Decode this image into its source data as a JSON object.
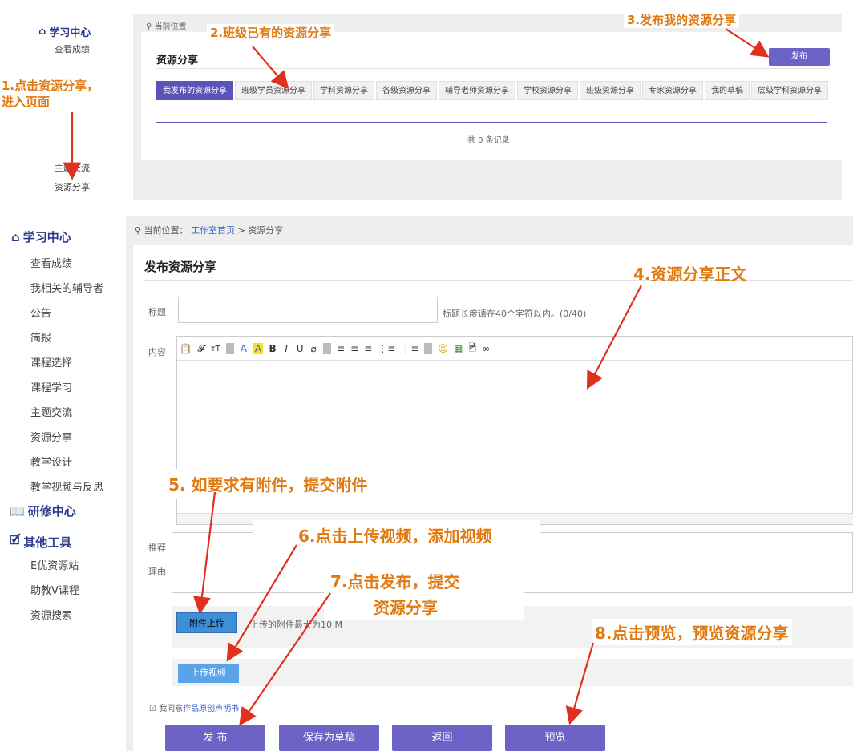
{
  "top": {
    "sidebar": {
      "head": "学习中心",
      "items": [
        "查看成绩",
        "主题交流",
        "资源分享"
      ]
    },
    "location": "当前位置",
    "section_title": "资源分享",
    "publish_button": "发布",
    "tabs": [
      "我发布的资源分享",
      "班级学员资源分享",
      "学科资源分享",
      "各级资源分享",
      "辅导老师资源分享",
      "学校资源分享",
      "班级资源分享",
      "专家资源分享",
      "我的草稿",
      "层级学科资源分享"
    ],
    "record_count": "共 0 条记录"
  },
  "bottom": {
    "sidebar": {
      "learning_head": "学习中心",
      "learning_items": [
        "查看成绩",
        "我相关的辅导者",
        "公告",
        "简报",
        "课程选择",
        "课程学习",
        "主题交流",
        "资源分享",
        "教学设计",
        "教学视频与反思"
      ],
      "research_head": "研修中心",
      "tools_head": "其他工具",
      "tools_items": [
        "E优资源站",
        "助教V课程",
        "资源搜索"
      ]
    },
    "breadcrumb": {
      "prefix": "当前位置：",
      "home": "工作室首页",
      "sep": ">",
      "current": "资源分享"
    },
    "form_title": "发布资源分享",
    "title_label": "标题",
    "title_hint": "标题长度请在40个字符以内。(0/40)",
    "content_label": "内容",
    "recommend_label_1": "推荐",
    "recommend_label_2": "理由",
    "attach_button": "附件上传",
    "attach_hint": "上传的附件最大为10 M",
    "upload_video_button": "上传视频",
    "agree_prefix": "我同意",
    "agree_link": "作品原创声明书",
    "buttons": {
      "publish": "发 布",
      "save_draft": "保存为草稿",
      "back": "返回",
      "preview": "预览"
    },
    "toolbar": [
      "📋",
      "𝓕",
      "тT",
      "A",
      "A",
      "B",
      "I",
      "U",
      "⌀",
      "≡",
      "≡",
      "≡",
      "⋮≡",
      "⋮≡",
      "☺",
      "▦",
      "🖻",
      "∞"
    ]
  },
  "annotations": {
    "a1_line1": "1.点击资源分享，",
    "a1_line2": "进入页面",
    "a2": "2.班级已有的资源分享",
    "a3": "3.发布我的资源分享",
    "a4": "4.资源分享正文",
    "a5": "5. 如要求有附件，提交附件",
    "a6": "6.点击上传视频，添加视频",
    "a7_line1": "7.点击发布，提交",
    "a7_line2": "资源分享",
    "a8": "8.点击预览，预览资源分享"
  },
  "colors": {
    "purple": "#6d63c7",
    "tab_active": "#5b54b8",
    "annot_red": "#e0301e",
    "annot_orange": "#e07a10",
    "link_blue": "#3a5fc8",
    "upload_blue": "#3e8fd6"
  }
}
